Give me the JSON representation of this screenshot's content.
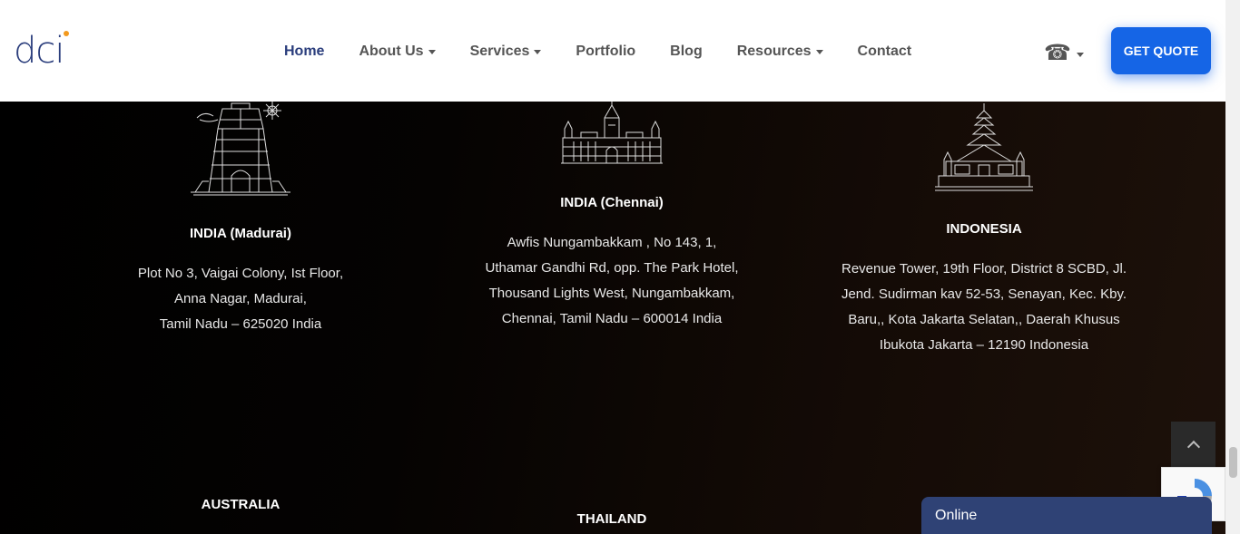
{
  "header": {
    "logo_text": "dci",
    "nav": [
      {
        "label": "Home",
        "dropdown": false,
        "active": true
      },
      {
        "label": "About Us",
        "dropdown": true
      },
      {
        "label": "Services",
        "dropdown": true
      },
      {
        "label": "Portfolio",
        "dropdown": false
      },
      {
        "label": "Blog",
        "dropdown": false
      },
      {
        "label": "Resources",
        "dropdown": true
      },
      {
        "label": "Contact",
        "dropdown": false
      }
    ],
    "phone_icon": "☎",
    "cta_label": "GET QUOTE"
  },
  "offices": [
    {
      "title": "INDIA (Madurai)",
      "address": [
        "Plot No 3, Vaigai Colony, Ist Floor,",
        "Anna Nagar, Madurai,",
        "Tamil Nadu – 625020 India"
      ]
    },
    {
      "title": "INDIA (Chennai)",
      "address": [
        "Awfis Nungambakkam , No 143, 1,",
        "Uthamar Gandhi Rd, opp. The Park Hotel,",
        "Thousand Lights West, Nungambakkam,",
        "Chennai, Tamil Nadu – 600014 India"
      ]
    },
    {
      "title": "INDONESIA",
      "address": [
        "Revenue Tower, 19th Floor, District 8 SCBD, Jl.",
        "Jend. Sudirman kav 52-53, Senayan, Kec. Kby.",
        "Baru,, Kota Jakarta Selatan,, Daerah Khusus",
        "Ibukota Jakarta – 12190 Indonesia"
      ]
    },
    {
      "title": "AUSTRALIA"
    },
    {
      "title": "THAILAND"
    }
  ],
  "chat": {
    "status": "Online"
  },
  "colors": {
    "brand": "#2a3d7c",
    "accent": "#1565e6",
    "chat": "#2f4275",
    "logo_dot": "#f39a1e"
  }
}
